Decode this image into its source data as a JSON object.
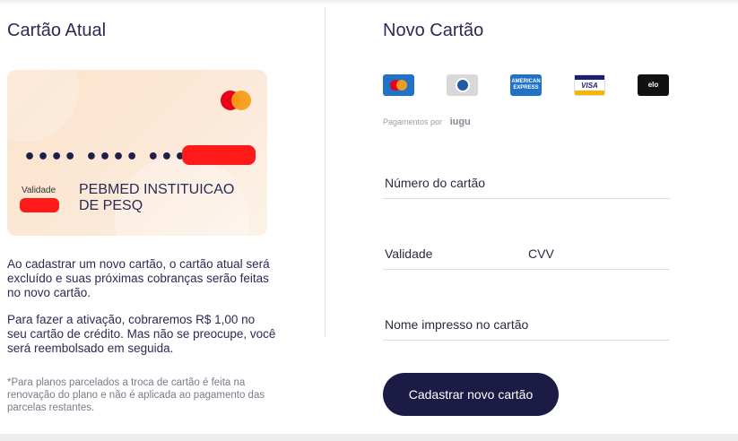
{
  "current_card": {
    "title": "Cartão Atual",
    "masked_number": "•••• •••• ••••",
    "validity_label": "Validade",
    "holder_name": "PEBMED INSTITUICAO DE PESQ",
    "brand_icon": "mastercard-logo"
  },
  "info": {
    "paragraph1": "Ao cadastrar um novo cartão, o cartão atual será excluído e suas próximas cobranças serão feitas no novo cartão.",
    "paragraph2": "Para fazer a ativação, cobraremos R$ 1,00 no seu cartão de crédito. Mas não se preocupe, você será reembolsado em seguida.",
    "footnote": "*Para planos parcelados a troca de cartão é feita na renovação do plano e não é aplicada ao pagamento das parcelas restantes."
  },
  "new_card": {
    "title": "Novo Cartão",
    "brands": [
      "mastercard",
      "diners",
      "american-express",
      "visa",
      "elo"
    ],
    "amex_text": "AMERICAN EXPRESS",
    "visa_text": "VISA",
    "elo_text": "elo",
    "payments_by": "Pagamentos por",
    "provider": "iugu",
    "fields": {
      "number": "Número do cartão",
      "validity": "Validade",
      "cvv": "CVV",
      "name": "Nome impresso no cartão"
    },
    "submit_label": "Cadastrar novo cartão"
  },
  "colors": {
    "primary": "#1b1b46",
    "card_bg": "#fde4cc",
    "redaction": "#ff1a1a"
  }
}
